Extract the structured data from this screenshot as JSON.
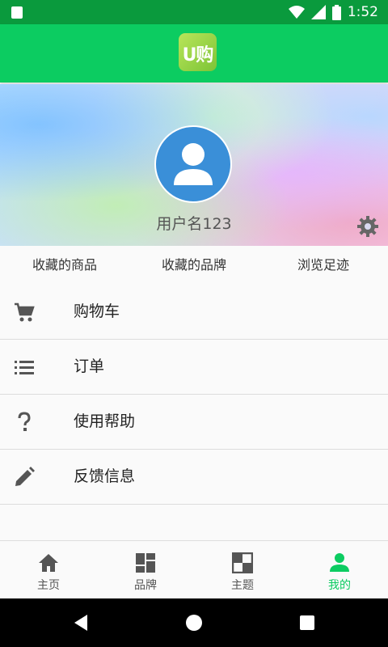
{
  "status": {
    "time": "1:52"
  },
  "appbar": {
    "logo_text": "U购"
  },
  "profile": {
    "username": "用户名123"
  },
  "shortcuts": [
    "收藏的商品",
    "收藏的品牌",
    "浏览足迹"
  ],
  "menu": {
    "cart": "购物车",
    "orders": "订单",
    "help": "使用帮助",
    "feedback": "反馈信息"
  },
  "tabs": {
    "home": "主页",
    "brand": "品牌",
    "theme": "主题",
    "mine": "我的"
  },
  "colors": {
    "accent": "#0ccc61",
    "status": "#0a9a3d",
    "avatar": "#3a8fd8"
  }
}
